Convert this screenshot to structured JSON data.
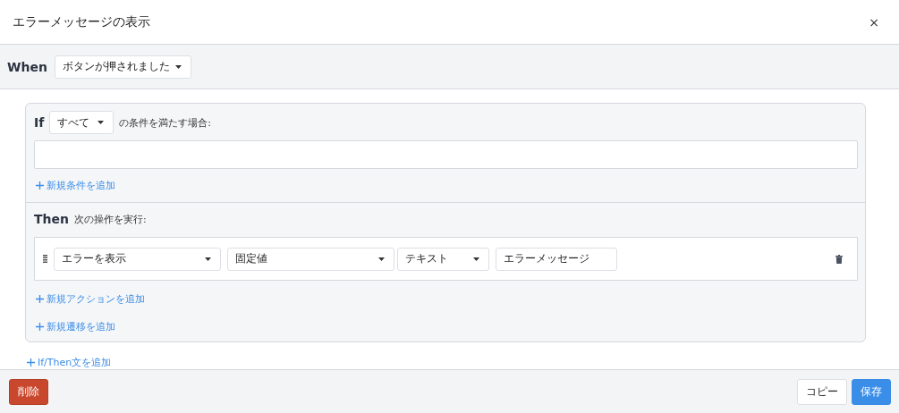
{
  "dialog": {
    "title": "エラーメッセージの表示",
    "close": "×"
  },
  "when": {
    "label": "When",
    "trigger": "ボタンが押されました"
  },
  "if": {
    "label": "If",
    "match": "すべて",
    "suffix": "の条件を満たす場合:",
    "add_condition": "新規条件を追加"
  },
  "then": {
    "label": "Then",
    "suffix": "次の操作を実行:",
    "actions": [
      {
        "action": "エラーを表示",
        "source": "固定値",
        "type": "テキスト",
        "value": "エラーメッセージ"
      }
    ],
    "add_action": "新規アクションを追加",
    "add_transition": "新規遷移を追加"
  },
  "add_statement": "If/Then文を追加",
  "footer": {
    "buttons": [
      {
        "label": "削除",
        "kind": "danger"
      },
      {
        "label": "コピー",
        "kind": "default"
      },
      {
        "label": "保存",
        "kind": "primary"
      }
    ]
  }
}
